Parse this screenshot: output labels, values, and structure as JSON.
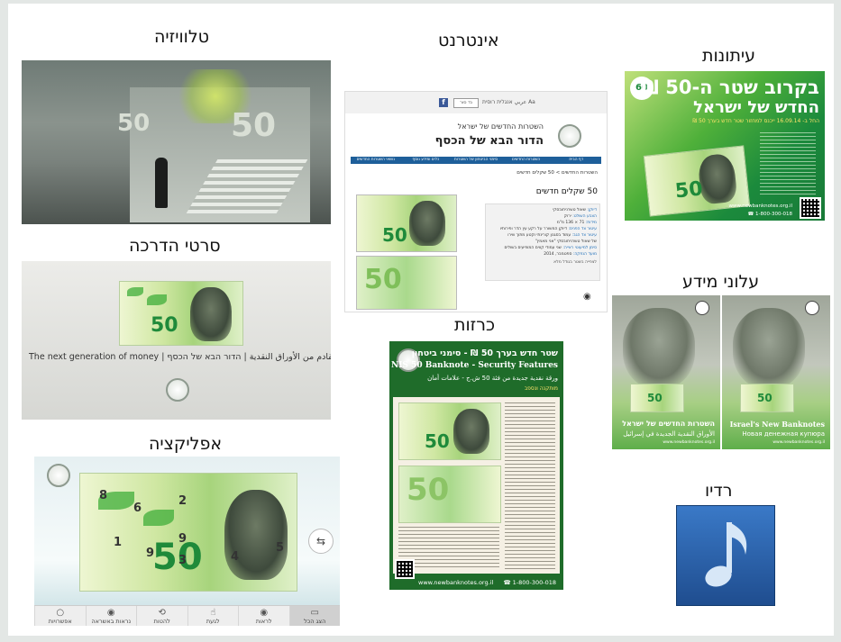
{
  "sections": {
    "tv": {
      "title": "טלוויזיה"
    },
    "internet": {
      "title": "אינטרנט"
    },
    "newspapers": {
      "title": "עיתונות"
    },
    "guide_films": {
      "title": "סרטי הדרכה"
    },
    "flyers": {
      "title": "עלוני מידע"
    },
    "application": {
      "title": "אפליקציה"
    },
    "posters": {
      "title": "כרזות"
    },
    "radio": {
      "title": "רדיו"
    }
  },
  "guide": {
    "tagline": "The next generation of money | الجيل القادم من الأوراق النقدية | הדור הבא של הכסף",
    "note_value": "50"
  },
  "application": {
    "note_value": "50",
    "hotspots": [
      "8",
      "6",
      "2",
      "1",
      "9",
      "9",
      "4",
      "3",
      "5"
    ],
    "tabs": [
      {
        "label": "הצג הכל",
        "icon": "page-icon"
      },
      {
        "label": "לראות",
        "icon": "eye-icon"
      },
      {
        "label": "לגעת",
        "icon": "hand-icon"
      },
      {
        "label": "להטות",
        "icon": "tilt-icon"
      },
      {
        "label": "נראות באשראה",
        "icon": "eye-icon"
      },
      {
        "label": "אפשרויות",
        "icon": "bulb-icon"
      }
    ]
  },
  "internet": {
    "facebook": "f",
    "search": "נד סור",
    "langs": "عربي  אנגלית  רוסית  Aa",
    "site_title_small": "השטרות החדשים של ישראל",
    "site_title_big": "הדור הבא של הכסף",
    "nav": [
      "דף הבית",
      "השטרות החדשים",
      "סימני הביטחון של השטרות",
      "כלים ומידע נוסף",
      "נושאי השטרות החדשים"
    ],
    "breadcrumb": "השטרות החדשים > 50 שקלים חדשים",
    "heading": "50 שקלים חדשים",
    "info_lines": [
      {
        "k": "דיוקן:",
        "v": "שאול טשרניחובסקי"
      },
      {
        "k": "הצבע השולט:",
        "v": "ירוק"
      },
      {
        "k": "מידות:",
        "v": "71 × 136 מ\"מ"
      },
      {
        "k": "עיטור צד הפנים:",
        "v": "דיוקן המשורר על רקע עץ הדר ופירותיו"
      },
      {
        "k": "עיטור צד הגב:",
        "v": "עמוד בסגנון קורינתי וקטע מתוך שירו"
      },
      {
        "k": "",
        "v": "של שאול טשרניחובסקי \"אני מאמין\""
      },
      {
        "k": "סימן למיעוטי ראייה:",
        "v": "שני עמודי קווים המופיעים בשולים"
      },
      {
        "k": "מועד הנפקה:",
        "v": "ספטמבר, 2014"
      }
    ],
    "info_foot": "לצפייה בשטר בגודל מלא",
    "note_value": "50"
  },
  "newspapers": {
    "headline_line1": "בקרוב שטר ה-50 ₪",
    "headline_line2": "החדש של ישראל",
    "subline": "החל ב- 16.09.14 ייכנס למחזור שטר חדש בערך 50 ₪",
    "site": "www.newbanknotes.org.il",
    "phone": "☎ 1-800-300-018",
    "badge": "60",
    "note_value": "50"
  },
  "flyers": {
    "left": {
      "title_he": "השטרות החדשים של ישראל",
      "title_ar": "الأوراق النقدية الجديدة في إسرائيل",
      "site": "www.newbanknotes.org.il"
    },
    "right": {
      "title_en": "Israel's New Banknotes",
      "title_ru": "Новая денежная купюра",
      "site": "www.newbanknotes.org.il"
    }
  },
  "posters": {
    "line1": "שטר חדש בערך 50 ₪ - סימני ביטחון",
    "line2": "New NIS 50 Banknote - Security Features",
    "line3": "ورقة نقدية جديدة من فئة 50 ش.ج - علامات أمان",
    "line4": "מותקנה ונספב",
    "site": "www.newbanknotes.org.il",
    "phone": "☎ 1-800-300-018",
    "note_value": "50"
  },
  "radio": {
    "icon": "music-note-icon"
  },
  "colors": {
    "banknote_green": "#1f8a3a",
    "poster_green": "#1f6c2a",
    "radio_blue": "#2a64ad",
    "web_nav_blue": "#1e5f9a"
  }
}
